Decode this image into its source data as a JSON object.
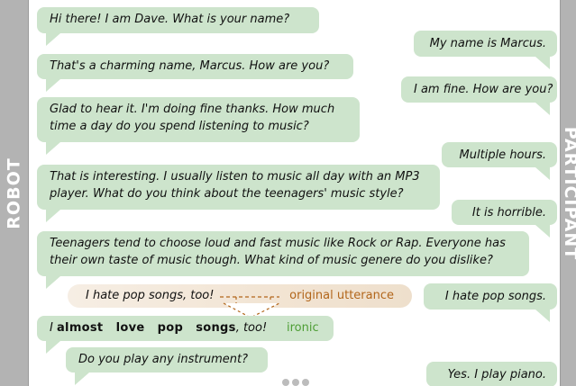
{
  "side_labels": {
    "left": "ROBOT",
    "right": "PARTICIPANT"
  },
  "messages": {
    "m1": "Hi there! I am Dave. What is your name?",
    "m2": "My name is Marcus.",
    "m3": "That's a charming name, Marcus. How are you?",
    "m4": "I am fine. How are you?",
    "m5_line1": "Glad to hear it. I'm doing fine thanks. How much",
    "m5_line2": "time a day do you spend listening to music?",
    "m6": "Multiple hours.",
    "m7_line1": "That is interesting. I usually listen to music all day with an MP3",
    "m7_line2": "player. What do you think about the teenagers' music style?",
    "m8": "It is horrible.",
    "m9_line1": "Teenagers tend to choose loud and fast music like Rock or Rap. Everyone has",
    "m9_line2": "their own taste of music though. What kind of music genere do you dislike?",
    "m10": "I hate pop songs.",
    "m11": "Do you play any instrument?",
    "m12": "Yes. I play piano."
  },
  "original": {
    "text": "I hate pop songs, too!",
    "label": "original utterance"
  },
  "ironic": {
    "w1": "I",
    "w2": "almost",
    "w3": "love",
    "w4": "pop",
    "w5": "songs",
    "w6": ", too!",
    "label": "ironic"
  },
  "colors": {
    "bubble": "#cde4cc",
    "side_bar": "#b3b3b3",
    "original_label": "#b2661b",
    "ironic_label": "#4e9e35",
    "arrow": "#b2661b"
  }
}
